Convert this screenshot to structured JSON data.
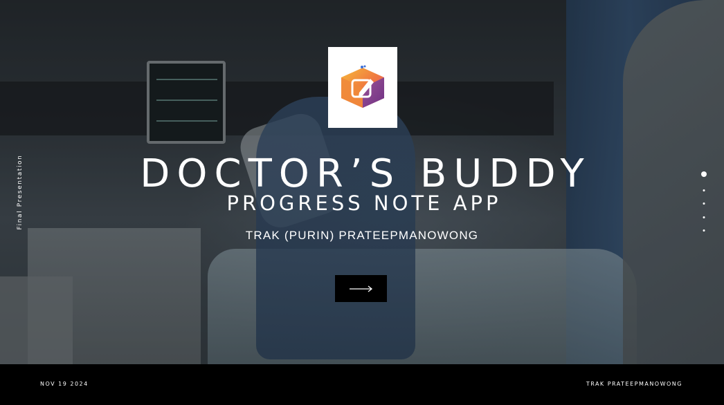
{
  "slide": {
    "side_label": "Final Presentation",
    "title": "DOCTOR’S BUDDY",
    "subtitle": "PROGRESS NOTE APP",
    "author": "TRAK (PURIN) PRATEEPMANOWONG",
    "next_icon": "long-arrow-right-icon",
    "logo_icon": "edit-note-cube-icon"
  },
  "navigation": {
    "slide_count": 5,
    "active_index": 0
  },
  "footer": {
    "date": "NOV 19 2024",
    "author": "TRAK PRATEEPMANOWONG"
  },
  "colors": {
    "background": "#000000",
    "text": "#ffffff",
    "logo_orange": "#f39a2e",
    "logo_purple": "#7a3d9a",
    "logo_pink": "#e0457b"
  }
}
